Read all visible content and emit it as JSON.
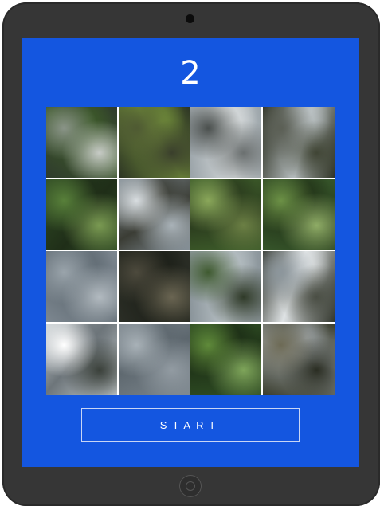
{
  "game": {
    "score": "2",
    "start_label": "START",
    "tiles": [
      {
        "scene": "rapids-with-fern",
        "colors": [
          "#2f3b2c",
          "#8a9488",
          "#3d5a2a",
          "#c7cbc6"
        ]
      },
      {
        "scene": "forest-floor-leaves",
        "colors": [
          "#2d3524",
          "#4f5a33",
          "#6f8a3a",
          "#3a3f2c"
        ]
      },
      {
        "scene": "water-over-rocks",
        "colors": [
          "#9aa3a8",
          "#4a4f4d",
          "#d7dbdc",
          "#6b7070"
        ]
      },
      {
        "scene": "stream-with-stones",
        "colors": [
          "#2c3022",
          "#5b5f55",
          "#b9c0c2",
          "#404535"
        ]
      },
      {
        "scene": "jungle-foliage",
        "colors": [
          "#2f4a24",
          "#58803a",
          "#1f2e18",
          "#7a9a52"
        ]
      },
      {
        "scene": "splashing-water",
        "colors": [
          "#7f8a92",
          "#d8dde0",
          "#3b3d35",
          "#a9b2b8"
        ]
      },
      {
        "scene": "tree-trunks-forest",
        "colors": [
          "#3d5c2a",
          "#8aa75a",
          "#2a3a1d",
          "#6b7f44"
        ]
      },
      {
        "scene": "dense-forest",
        "colors": [
          "#36552a",
          "#6c9146",
          "#223318",
          "#8fac66"
        ]
      },
      {
        "scene": "blurred-water",
        "colors": [
          "#7d8790",
          "#9aa4ab",
          "#5f6a72",
          "#b2bac0"
        ]
      },
      {
        "scene": "dark-rocks-twigs",
        "colors": [
          "#2b2e26",
          "#4d4a3d",
          "#1c1f18",
          "#6a6552"
        ]
      },
      {
        "scene": "water-and-moss",
        "colors": [
          "#8a949a",
          "#3f5a30",
          "#b7c0c4",
          "#2f3a28"
        ]
      },
      {
        "scene": "rocks-rushing-water",
        "colors": [
          "#2d3128",
          "#8c969c",
          "#dfe3e5",
          "#4a4e44"
        ]
      },
      {
        "scene": "white-rapids",
        "colors": [
          "#c8cfd2",
          "#ffffff",
          "#6d757a",
          "#3a403a"
        ]
      },
      {
        "scene": "waterfall-blur",
        "colors": [
          "#7c868d",
          "#a8b1b7",
          "#5d676e",
          "#929ba2"
        ]
      },
      {
        "scene": "green-leaves",
        "colors": [
          "#2d4a22",
          "#5f8a3a",
          "#1b2c15",
          "#7ea55a"
        ]
      },
      {
        "scene": "shallow-stream-pebbles",
        "colors": [
          "#3a3d2e",
          "#6d6a55",
          "#9aa0a2",
          "#2a2d22"
        ]
      }
    ]
  }
}
